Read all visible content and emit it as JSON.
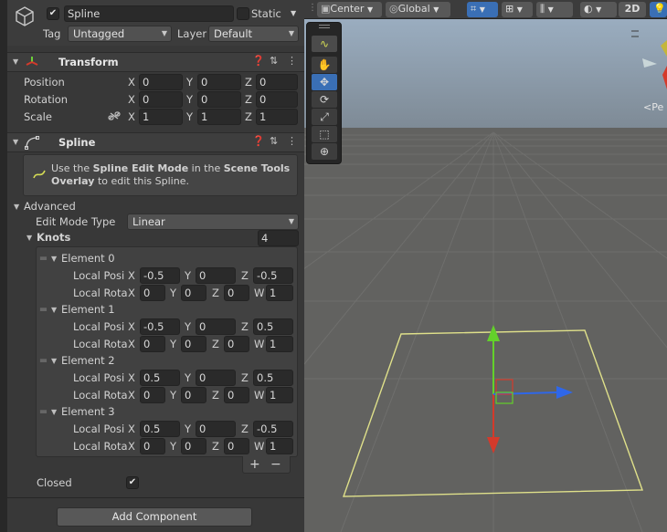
{
  "object": {
    "name": "Spline",
    "static_label": "Static",
    "tag_label": "Tag",
    "tag_value": "Untagged",
    "layer_label": "Layer",
    "layer_value": "Default"
  },
  "transform": {
    "title": "Transform",
    "rows": [
      {
        "label": "Position",
        "x": "0",
        "y": "0",
        "z": "0"
      },
      {
        "label": "Rotation",
        "x": "0",
        "y": "0",
        "z": "0"
      },
      {
        "label": "Scale",
        "x": "1",
        "y": "1",
        "z": "1"
      }
    ]
  },
  "spline": {
    "title": "Spline",
    "info": {
      "pre": "Use the",
      "bold1": "Spline Edit Mode",
      "mid": "in the",
      "bold2": "Scene Tools",
      "bold3": "Overlay",
      "post": "to edit this Spline."
    },
    "advanced_label": "Advanced",
    "edit_mode_label": "Edit Mode Type",
    "edit_mode_value": "Linear",
    "knots_label": "Knots",
    "knots_count": "4",
    "elements": [
      {
        "label": "Element 0",
        "pos_label": "Local Posi",
        "rot_label": "Local Rota",
        "pos": [
          "-0.5",
          "0",
          "-0.5"
        ],
        "rot": [
          "0",
          "0",
          "0",
          "1"
        ]
      },
      {
        "label": "Element 1",
        "pos_label": "Local Posi",
        "rot_label": "Local Rota",
        "pos": [
          "-0.5",
          "0",
          "0.5"
        ],
        "rot": [
          "0",
          "0",
          "0",
          "1"
        ]
      },
      {
        "label": "Element 2",
        "pos_label": "Local Posi",
        "rot_label": "Local Rota",
        "pos": [
          "0.5",
          "0",
          "0.5"
        ],
        "rot": [
          "0",
          "0",
          "0",
          "1"
        ]
      },
      {
        "label": "Element 3",
        "pos_label": "Local Posi",
        "rot_label": "Local Rota",
        "pos": [
          "0.5",
          "0",
          "-0.5"
        ],
        "rot": [
          "0",
          "0",
          "0",
          "1"
        ]
      }
    ],
    "plus": "+",
    "minus": "−",
    "closed_label": "Closed",
    "closed_checked": "✔"
  },
  "add_component": "Add Component",
  "scene_toolbar": {
    "pivot": "Center",
    "space": "Global",
    "mode_2d": "2D"
  },
  "scene_gizmo_label": "<Pe",
  "axis_letters": {
    "x": "X",
    "y": "Y",
    "z": "Z",
    "w": "W"
  },
  "colors": {
    "spline": "#dfe08a",
    "axis_x": "#d43a2b",
    "axis_y": "#63d12a",
    "axis_z": "#2f67e8",
    "selection": "#3a6fb5"
  }
}
